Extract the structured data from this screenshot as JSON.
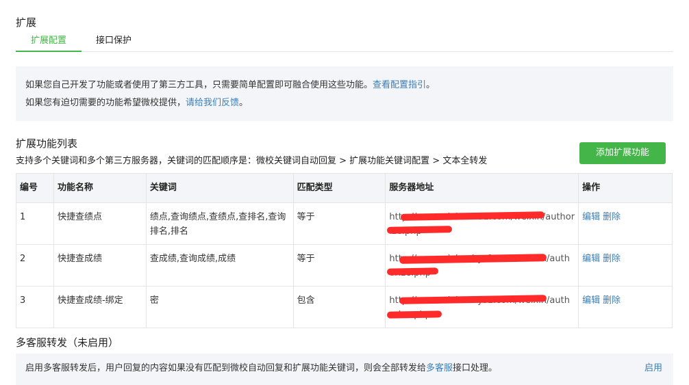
{
  "page": {
    "title": "扩展"
  },
  "tabs": [
    {
      "label": "扩展配置",
      "active": true
    },
    {
      "label": "接口保护",
      "active": false
    }
  ],
  "notice": {
    "line1_text": "如果您自己开发了功能或者使用了第三方工具，只需要简单配置即可融合使用这些功能。",
    "line1_link": "查看配置指引",
    "line1_end": "。",
    "line2_text": "如果您有迫切需要的功能希望微校提供，",
    "line2_link": "请给我们反馈",
    "line2_end": "。"
  },
  "section": {
    "title": "扩展功能列表",
    "desc": "支持多个关键词和多个第三方服务器，关键词的匹配顺序是：微校关键词自动回复 > 扩展功能关键词配置 > 文本全转发",
    "add_button": "添加扩展功能"
  },
  "table": {
    "headers": [
      "编号",
      "功能名称",
      "关键词",
      "匹配类型",
      "服务器地址",
      "操作"
    ],
    "rows": [
      {
        "id": "1",
        "name": "快捷查绩点",
        "keywords": "绩点,查询绩点,查绩点,查排名,查询排名,排名",
        "match": "等于",
        "server": "http://newweixin.ab31.com/weixin/authorize.php",
        "edit": "编辑",
        "delete": "删除"
      },
      {
        "id": "2",
        "name": "快捷查成绩",
        "keywords": "查成绩,查询成绩,成绩",
        "match": "等于",
        "server": "http://newweixin.abys1.com/weixin/authorize.php",
        "edit": "编辑",
        "delete": "删除"
      },
      {
        "id": "3",
        "name": "快捷查成绩-绑定",
        "keywords": "密",
        "match": "包含",
        "server": "http://newweixin.abys1.com/weixin/authorize.php",
        "edit": "编辑",
        "delete": "删除"
      }
    ]
  },
  "kf": {
    "title": "多客服转发（未启用）",
    "desc_pre": "启用多客服转发后，用户回复的内容如果没有匹配到微校自动回复和扩展功能关键词，则会全部转发给",
    "desc_link": "多客服",
    "desc_post": "接口处理。",
    "enable": "启用"
  },
  "colors": {
    "accent": "#44b549",
    "link": "#3a7eb5",
    "redact": "#ff2a2a"
  }
}
